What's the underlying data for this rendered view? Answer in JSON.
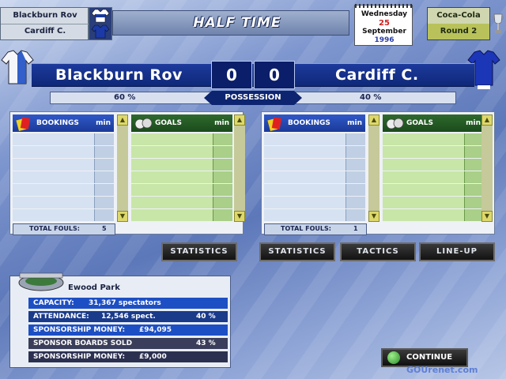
{
  "header": {
    "home_team_short": "Blackburn Rov",
    "away_team_short": "Cardiff C.",
    "title": "HALF TIME",
    "date": {
      "weekday": "Wednesday",
      "day": "25",
      "month": "September",
      "year": "1996"
    },
    "competition": "Coca-Cola",
    "round": "Round 2"
  },
  "score": {
    "home_team": "Blackburn Rov",
    "away_team": "Cardiff C.",
    "home_goals": "0",
    "away_goals": "0"
  },
  "possession": {
    "label": "POSSESSION",
    "home": "60 %",
    "away": "40 %",
    "home_value": 60,
    "away_value": 40
  },
  "home_panel": {
    "bookings_label": "BOOKINGS",
    "goals_label": "GOALS",
    "min_label": "min",
    "fouls_label": "TOTAL FOULS:",
    "fouls": "5"
  },
  "away_panel": {
    "bookings_label": "BOOKINGS",
    "goals_label": "GOALS",
    "min_label": "min",
    "fouls_label": "TOTAL FOULS:",
    "fouls": "1"
  },
  "buttons": {
    "home_statistics": "STATISTICS",
    "away_statistics": "STATISTICS",
    "tactics": "TACTICS",
    "lineup": "LINE-UP",
    "continue": "CONTINUE"
  },
  "stadium": {
    "name": "Ewood Park",
    "capacity_label": "CAPACITY:",
    "capacity": "31,367 spectators",
    "attendance_label": "ATTENDANCE:",
    "attendance": "12,546 spect.",
    "attendance_pct": "40 %",
    "sponsorship_label": "SPONSORSHIP MONEY:",
    "sponsorship": "£94,095",
    "boards_label": "SPONSOR BOARDS SOLD",
    "boards_pct": "43 %",
    "sponsorship2_label": "SPONSORSHIP MONEY:",
    "sponsorship2": "£9,000"
  },
  "watermark": "GOUrenet.com",
  "colors": {
    "home_blue": "#1b3a98",
    "goals_green": "#1b4a1b",
    "row_blue": "#d6e2f2",
    "row_green": "#c8e6a8"
  }
}
